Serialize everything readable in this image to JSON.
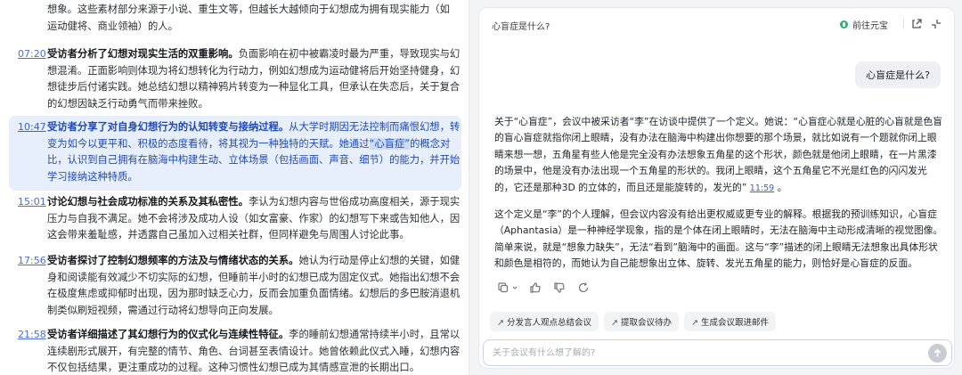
{
  "transcript": {
    "intro": "想象。这些素材部分来源于小说、重生文等，但越长大越倾向于幻想成为拥有现实能力（如运动健将、商业领袖）的人。",
    "entries": [
      {
        "time": "07:20",
        "heading": "受访者分析了幻想对现实生活的双重影响。",
        "body": "负面影响在初中被霸凌时最为严重，导致现实与幻想混淆。正面影响则体现为将幻想转化为行动力，例如幻想成为运动健将后开始坚持健身，幻想徒步后付诸实践。她总结幻想以精神鸦片转变为一种显化工具，但承认在失恋后，关于复合的幻想因缺乏行动勇气而带来挫败。"
      },
      {
        "time": "10:47",
        "heading": "受访者分享了对自身幻想行为的认知转变与接纳过程。",
        "body_pre": "从大学时期因无法控制而痛恨幻想，转变为如今以更平和、积极的态度看待，将其视为一种独特的天赋。她通过",
        "body_mark": "“心盲症”",
        "body_post": "的概念对比，认识到自己拥有在脑海中构建生动、立体场景（包括画面、声音、细节）的能力，并开始学习接纳这种特质。"
      },
      {
        "time": "15:01",
        "heading": "讨论幻想与社会成功标准的关系及其私密性。",
        "body": "李认为幻想内容与世俗成功高度相关，源于现实压力与自我不满足。她不会将涉及成功人设（如女富豪、作家）的幻想写下来或告知他人，因这会带来羞耻感，并透露自己虽加入过相关社群，但同样避免与周围人讨论此事。"
      },
      {
        "time": "17:56",
        "heading": "受访者探讨了控制幻想频率的方法及与情绪状态的关系。",
        "body": "她认为行动是停止幻想的关键，如健身和阅读能有效减少不切实际的幻想，但睡前半小时的幻想已成为固定仪式。她指出幻想不会在极度焦虑或抑郁时出现，因为那时缺乏心力，反而会加重负面情绪。幻想后的多巴胺消退机制类似刷短视频，需通过行动将幻想导向正向发展。"
      },
      {
        "time": "21:58",
        "heading": "受访者详细描述了其幻想行为的仪式化与连续性特征。",
        "body": "李的睡前幻想通常持续半小时，且常以连续剧形式展开，有完整的情节、角色、台词甚至表情设计。她曾依赖此仪式入睡，幻想内容不仅包括结果，更注重成功的过程。这种习惯性幻想已成为其情感宣泄的长期出口。"
      }
    ]
  },
  "chat": {
    "title": "心盲症是什么?",
    "goto_label": "前往元宝",
    "user_question": "心盲症是什么?",
    "answer_p1": "关于“心盲症”，会议中被采访者“李”在访谈中提供了一个定义。她说：“心盲症心就是心脏的心盲就是色盲的盲心盲症就指你闭上眼睛，没有办法在脑海中构建出你想要的那个场景，就比如说有一个题就你闭上眼睛来想一想，五角星有些人他是完全没有办法想象五角星的这个形状，颜色就是他闭上眼睛，在一片黑漆的场景中，他是没有办法出现一个五角星的形状的。我闭上眼睛，这个五角星它不光是红色的闪闪发光的，它还是那种3D 的立体的，而且还是能旋转的，发光的”",
    "answer_p1_cite": "11:59",
    "answer_p1_end": "。",
    "answer_p2": "这个定义是“李”的个人理解，但会议内容没有给出更权威或更专业的解释。根据我的预训练知识，心盲症（Aphantasia）是一种神经学现象，指的是个体在闭上眼睛时，无法在脑海中主动形成清晰的视觉图像。简单来说，就是“想象力缺失”，无法“看到”脑海中的画面。这与“李”描述的闭上眼睛无法想象出具体形状和颜色是相符的，而她认为自己能想象出立体、旋转、发光五角星的能力，则恰好是心盲症的反面。",
    "chips": [
      "分发言人观点总结会议",
      "提取会议待办",
      "生成会议跟进邮件"
    ],
    "input_placeholder": "关于会议有什么想了解的?"
  },
  "icons": {
    "goto": "yuanbao-logo-icon",
    "header": [
      "share-icon",
      "collapse-icon"
    ],
    "actions": [
      "copy-icon",
      "thumbs-up-icon",
      "thumbs-down-icon",
      "regenerate-icon"
    ],
    "send": "send-arrow-icon"
  },
  "colors": {
    "highlight_bg": "#e7effc",
    "highlight_text": "#2048b3",
    "timestamp": "#4a6fd4",
    "accent_green": "#22b573"
  }
}
